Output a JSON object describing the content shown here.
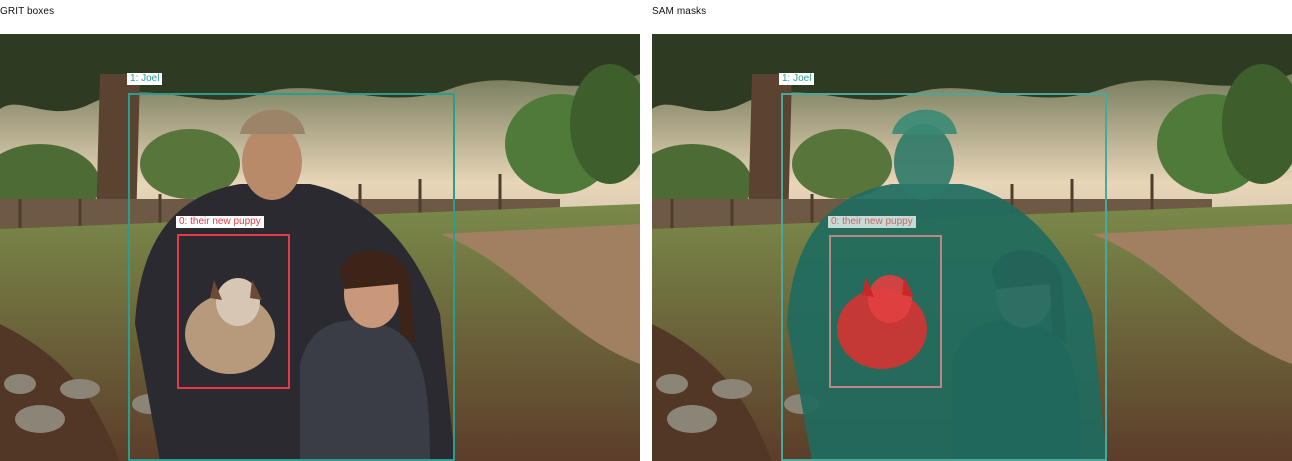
{
  "panels": [
    {
      "title": "GRIT boxes",
      "boxes": [
        {
          "label": "1: Joel",
          "color": "#2a9d8f"
        },
        {
          "label": "0: their new puppy",
          "color": "#e63946"
        }
      ]
    },
    {
      "title": "SAM masks",
      "boxes": [
        {
          "label": "1: Joel",
          "color": "#2a9d8f"
        },
        {
          "label": "0: their new puppy",
          "color": "#e63946"
        }
      ],
      "mask_colors": {
        "person": "#1f6b5e",
        "puppy": "#e03030"
      }
    }
  ]
}
